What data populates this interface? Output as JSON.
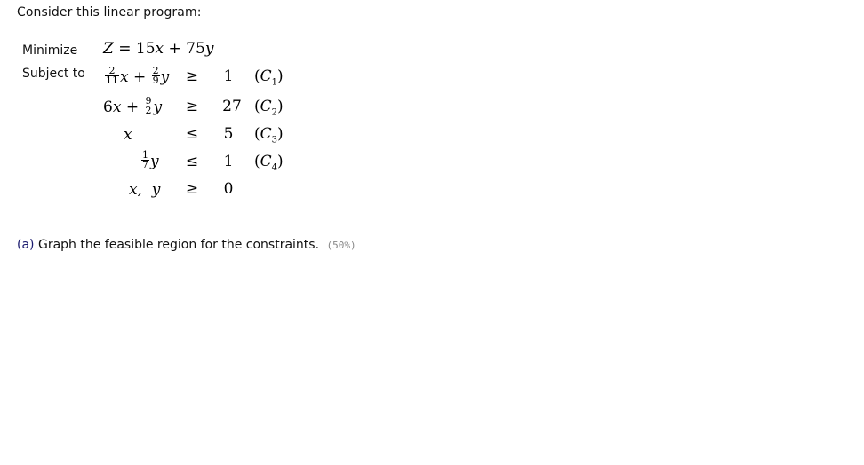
{
  "intro": "Consider this linear program:",
  "objective": {
    "label": "Minimize",
    "lhs": "Z",
    "eq": "=",
    "c1": "15",
    "var1": "x",
    "plus": "+",
    "c2": "75",
    "var2": "y"
  },
  "subject_to_label": "Subject to",
  "constraints": [
    {
      "id": "C1",
      "terms": [
        {
          "num": "2",
          "den": "11",
          "var": "x"
        },
        {
          "num": "2",
          "den": "9",
          "var": "y"
        }
      ],
      "relation": "≥",
      "rhs": "1",
      "name": "C",
      "sub": "1"
    },
    {
      "id": "C2",
      "terms": [
        {
          "coef": "6",
          "var": "x"
        },
        {
          "num": "9",
          "den": "2",
          "var": "y"
        }
      ],
      "relation": "≥",
      "rhs": "27",
      "name": "C",
      "sub": "2"
    },
    {
      "id": "C3",
      "terms": [
        {
          "var": "x"
        }
      ],
      "relation": "≤",
      "rhs": "5",
      "name": "C",
      "sub": "3"
    },
    {
      "id": "C4",
      "terms": [
        {
          "num": "1",
          "den": "7",
          "var": "y"
        }
      ],
      "relation": "≤",
      "rhs": "1",
      "name": "C",
      "sub": "4"
    },
    {
      "id": "nonneg",
      "lhs_text": "x,  y",
      "relation": "≥",
      "rhs": "0"
    }
  ],
  "question": {
    "label": "(a)",
    "text": "Graph the feasible region for the constraints.",
    "weight": "(50%)"
  }
}
